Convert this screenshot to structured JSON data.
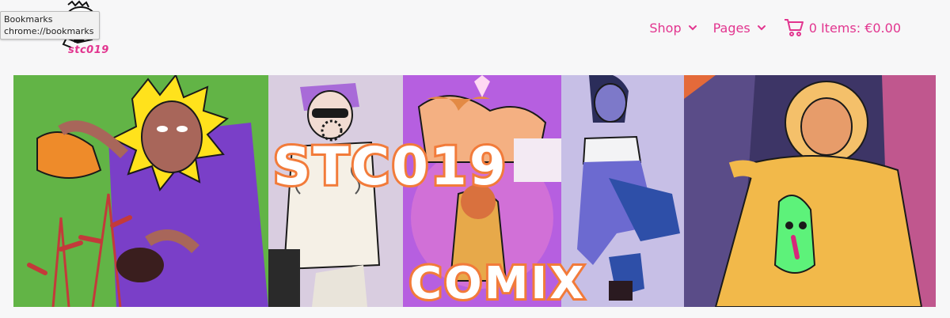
{
  "tooltip": {
    "title": "Bookmarks",
    "url": "chrome://bookmarks"
  },
  "logo": {
    "text": "stc019",
    "color": "#e2358f"
  },
  "nav": {
    "shop_label": "Shop",
    "pages_label": "Pages",
    "cart_label": "0 Items: €0.00",
    "accent": "#e2358f"
  },
  "banner": {
    "title_line1": "STC019",
    "title_line2": "COMIX",
    "title_outline_color": "#f27b3a"
  }
}
